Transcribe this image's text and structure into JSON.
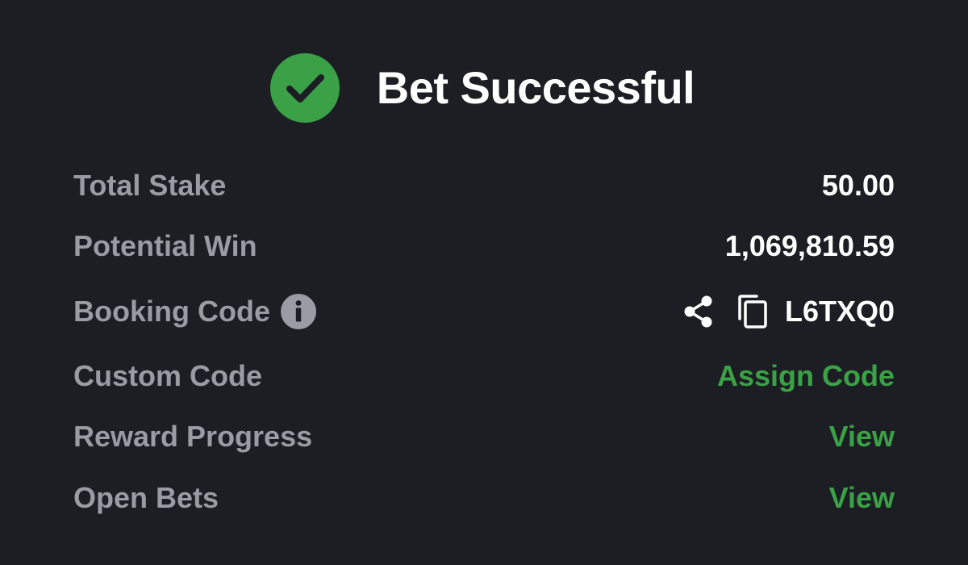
{
  "header": {
    "title": "Bet Successful",
    "icon": "check-circle-icon",
    "icon_color": "#3aa146"
  },
  "rows": [
    {
      "label": "Total Stake",
      "value": "50.00"
    },
    {
      "label": "Potential Win",
      "value": "1,069,810.59"
    },
    {
      "label": "Booking Code",
      "value": "L6TXQ0",
      "label_icon": "info-icon",
      "actions": [
        "share-icon",
        "copy-icon"
      ]
    },
    {
      "label": "Custom Code",
      "value": "Assign Code"
    },
    {
      "label": "Reward Progress",
      "value": "View"
    },
    {
      "label": "Open Bets",
      "value": "View"
    }
  ],
  "colors": {
    "background": "#1d1e23",
    "label": "#9a9ba3",
    "value": "#ffffff",
    "link": "#3aa146"
  }
}
